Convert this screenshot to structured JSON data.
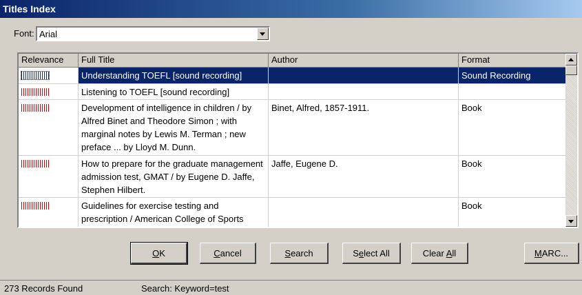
{
  "window": {
    "title": "Titles Index"
  },
  "font": {
    "label": "Font:",
    "value": "Arial"
  },
  "table": {
    "columns": [
      "Relevance",
      "Full Title",
      "Author",
      "Format"
    ],
    "rows": [
      {
        "title": "Understanding TOEFL [sound recording]",
        "author": "",
        "format": "Sound Recording",
        "selected": true
      },
      {
        "title": "Listening to TOEFL [sound recording]",
        "author": "",
        "format": ""
      },
      {
        "title": "Development of intelligence in children / by Alfred Binet and Theodore Simon ; with marginal notes by Lewis M. Terman ; new preface ... by Lloyd M. Dunn.",
        "author": "Binet, Alfred, 1857-1911.",
        "format": "Book"
      },
      {
        "title": "How to prepare for the graduate management admission test, GMAT / by Eugene D. Jaffe, Stephen Hilbert.",
        "author": "Jaffe, Eugene D.",
        "format": "Book"
      },
      {
        "title": "Guidelines for exercise testing and prescription / American College of Sports Medicine.",
        "author": "",
        "format": "Book"
      }
    ]
  },
  "buttons": {
    "ok": {
      "mnemonic": "O",
      "rest": "K"
    },
    "cancel": {
      "mnemonic": "C",
      "rest": "ancel"
    },
    "search": {
      "mnemonic": "S",
      "rest": "earch"
    },
    "select_all": {
      "pre": "S",
      "mnemonic": "e",
      "rest": "lect All"
    },
    "clear_all": {
      "pre": "Clear ",
      "mnemonic": "A",
      "rest": "ll"
    },
    "marc": {
      "mnemonic": "M",
      "rest": "ARC..."
    }
  },
  "status": {
    "records": "273 Records Found",
    "search": "Search: Keyword=test"
  },
  "colors": {
    "selection": "#0a246a",
    "relevance_bar": "#cc0000",
    "face": "#d4d0c8"
  }
}
